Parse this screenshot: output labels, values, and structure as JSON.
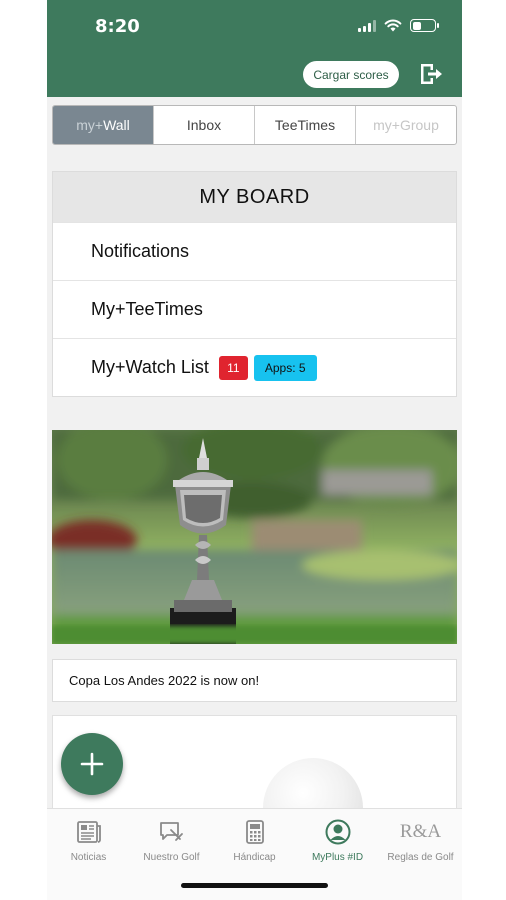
{
  "status_bar": {
    "time": "8:20"
  },
  "header": {
    "cargar_label": "Cargar scores",
    "logout_icon": "logout-icon"
  },
  "tabs": [
    {
      "prefix": "my+",
      "label": "Wall",
      "active": true
    },
    {
      "prefix": "",
      "label": "Inbox",
      "active": false
    },
    {
      "prefix": "",
      "label": "TeeTimes",
      "active": false
    },
    {
      "prefix": "my+",
      "label": "Group",
      "active": false
    }
  ],
  "board": {
    "title": "MY BOARD",
    "items": [
      {
        "label": "Notifications"
      },
      {
        "label": "My+TeeTimes"
      },
      {
        "label": "My+Watch List",
        "badge_count": "11",
        "badge_apps": "Apps: 5"
      }
    ]
  },
  "news": {
    "caption": "Copa Los Andes 2022 is now on!"
  },
  "fab": {
    "icon": "plus-icon"
  },
  "bottom_nav": [
    {
      "label": "Noticias",
      "icon": "news-icon"
    },
    {
      "label": "Nuestro Golf",
      "icon": "chat-icon"
    },
    {
      "label": "Hándicap",
      "icon": "calculator-icon"
    },
    {
      "label": "MyPlus #ID",
      "icon": "profile-icon",
      "active": true
    },
    {
      "label": "Reglas de Golf",
      "icon": "ra-logo-icon",
      "logo_text": "R&A"
    }
  ],
  "colors": {
    "brand_green": "#3e7a5d",
    "active_tab": "#7a8791",
    "badge_red": "#e0242f",
    "badge_blue": "#17c2ef"
  }
}
